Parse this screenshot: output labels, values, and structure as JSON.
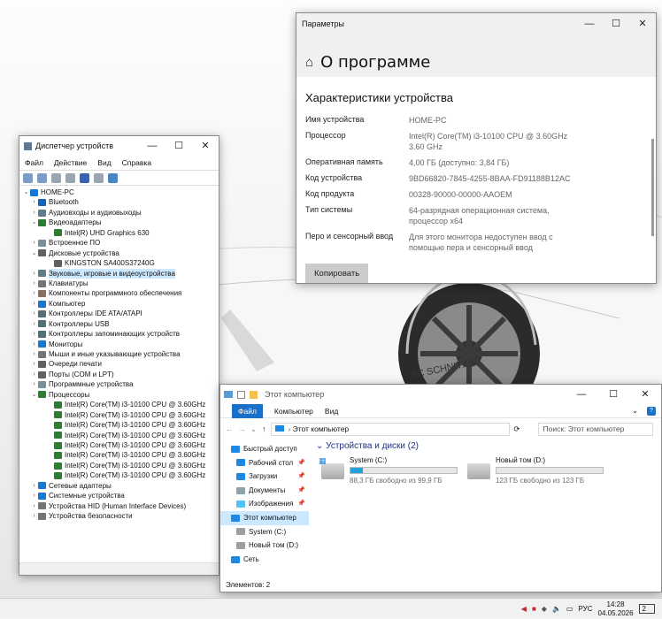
{
  "settings": {
    "window_title": "Параметры",
    "page_title": "О программе",
    "section_title": "Характеристики устройства",
    "specs": [
      {
        "key": "Имя устройства",
        "value": "HOME-PC"
      },
      {
        "key": "Процессор",
        "value": "Intel(R) Core(TM) i3-10100 CPU @ 3.60GHz 3.60 GHz"
      },
      {
        "key": "Оперативная память",
        "value": "4,00 ГБ (доступно: 3,84 ГБ)"
      },
      {
        "key": "Код устройства",
        "value": "9BD66820-7845-4255-8BAA-FD91188B12AC"
      },
      {
        "key": "Код продукта",
        "value": "00328-90000-00000-AAOEM"
      },
      {
        "key": "Тип системы",
        "value": "64-разрядная операционная система, процессор x64"
      },
      {
        "key": "Перо и сенсорный ввод",
        "value": "Для этого монитора недоступен ввод с помощью пера и сенсорный ввод"
      }
    ],
    "copy_button": "Копировать"
  },
  "devmgr": {
    "window_title": "Диспетчер устройств",
    "menu": [
      "Файл",
      "Действие",
      "Вид",
      "Справка"
    ],
    "root": "HOME-PC",
    "nodes": [
      {
        "label": "Bluetooth",
        "level": 1,
        "arrow": "›",
        "icon": "bluetooth-icon",
        "color": "#1565c0"
      },
      {
        "label": "Аудиовходы и аудиовыходы",
        "level": 1,
        "arrow": "›",
        "icon": "speaker-icon",
        "color": "#607d8b"
      },
      {
        "label": "Видеоадаптеры",
        "level": 1,
        "arrow": "⌄",
        "icon": "display-adapter-icon",
        "color": "#2e7d32"
      },
      {
        "label": "Intel(R) UHD Graphics 630",
        "level": 2,
        "arrow": "",
        "icon": "display-adapter-icon",
        "color": "#2e7d32"
      },
      {
        "label": "Встроенное ПО",
        "level": 1,
        "arrow": "›",
        "icon": "firmware-icon",
        "color": "#78909c"
      },
      {
        "label": "Дисковые устройства",
        "level": 1,
        "arrow": "⌄",
        "icon": "disk-icon",
        "color": "#616161"
      },
      {
        "label": "KINGSTON SA400S37240G",
        "level": 2,
        "arrow": "",
        "icon": "disk-icon",
        "color": "#616161"
      },
      {
        "label": "Звуковые, игровые и видеоустройства",
        "level": 1,
        "arrow": "›",
        "icon": "sound-icon",
        "color": "#607d8b",
        "selected": true
      },
      {
        "label": "Клавиатуры",
        "level": 1,
        "arrow": "›",
        "icon": "keyboard-icon",
        "color": "#757575"
      },
      {
        "label": "Компоненты программного обеспечения",
        "level": 1,
        "arrow": "›",
        "icon": "software-icon",
        "color": "#8d6e63"
      },
      {
        "label": "Компьютер",
        "level": 1,
        "arrow": "›",
        "icon": "computer-icon",
        "color": "#1976d2"
      },
      {
        "label": "Контроллеры IDE ATA/ATAPI",
        "level": 1,
        "arrow": "›",
        "icon": "controller-icon",
        "color": "#546e7a"
      },
      {
        "label": "Контроллеры USB",
        "level": 1,
        "arrow": "›",
        "icon": "usb-icon",
        "color": "#546e7a"
      },
      {
        "label": "Контроллеры запоминающих устройств",
        "level": 1,
        "arrow": "›",
        "icon": "storage-icon",
        "color": "#546e7a"
      },
      {
        "label": "Мониторы",
        "level": 1,
        "arrow": "›",
        "icon": "monitor-icon",
        "color": "#1976d2"
      },
      {
        "label": "Мыши и иные указывающие устройства",
        "level": 1,
        "arrow": "›",
        "icon": "mouse-icon",
        "color": "#757575"
      },
      {
        "label": "Очереди печати",
        "level": 1,
        "arrow": "›",
        "icon": "printer-icon",
        "color": "#616161"
      },
      {
        "label": "Порты (COM и LPT)",
        "level": 1,
        "arrow": "›",
        "icon": "port-icon",
        "color": "#616161"
      },
      {
        "label": "Программные устройства",
        "level": 1,
        "arrow": "›",
        "icon": "software-device-icon",
        "color": "#78909c"
      },
      {
        "label": "Процессоры",
        "level": 1,
        "arrow": "⌄",
        "icon": "processor-icon",
        "color": "#2e7d32"
      },
      {
        "label": "Intel(R) Core(TM) i3-10100 CPU @ 3.60GHz",
        "level": 2,
        "arrow": "",
        "icon": "processor-icon",
        "color": "#2e7d32"
      },
      {
        "label": "Intel(R) Core(TM) i3-10100 CPU @ 3.60GHz",
        "level": 2,
        "arrow": "",
        "icon": "processor-icon",
        "color": "#2e7d32"
      },
      {
        "label": "Intel(R) Core(TM) i3-10100 CPU @ 3.60GHz",
        "level": 2,
        "arrow": "",
        "icon": "processor-icon",
        "color": "#2e7d32"
      },
      {
        "label": "Intel(R) Core(TM) i3-10100 CPU @ 3.60GHz",
        "level": 2,
        "arrow": "",
        "icon": "processor-icon",
        "color": "#2e7d32"
      },
      {
        "label": "Intel(R) Core(TM) i3-10100 CPU @ 3.60GHz",
        "level": 2,
        "arrow": "",
        "icon": "processor-icon",
        "color": "#2e7d32"
      },
      {
        "label": "Intel(R) Core(TM) i3-10100 CPU @ 3.60GHz",
        "level": 2,
        "arrow": "",
        "icon": "processor-icon",
        "color": "#2e7d32"
      },
      {
        "label": "Intel(R) Core(TM) i3-10100 CPU @ 3.60GHz",
        "level": 2,
        "arrow": "",
        "icon": "processor-icon",
        "color": "#2e7d32"
      },
      {
        "label": "Intel(R) Core(TM) i3-10100 CPU @ 3.60GHz",
        "level": 2,
        "arrow": "",
        "icon": "processor-icon",
        "color": "#2e7d32"
      },
      {
        "label": "Сетевые адаптеры",
        "level": 1,
        "arrow": "›",
        "icon": "network-adapter-icon",
        "color": "#1976d2"
      },
      {
        "label": "Системные устройства",
        "level": 1,
        "arrow": "›",
        "icon": "system-device-icon",
        "color": "#1976d2"
      },
      {
        "label": "Устройства HID (Human Interface Devices)",
        "level": 1,
        "arrow": "›",
        "icon": "hid-icon",
        "color": "#757575"
      },
      {
        "label": "Устройства безопасности",
        "level": 1,
        "arrow": "›",
        "icon": "security-device-icon",
        "color": "#757575"
      }
    ]
  },
  "explorer": {
    "window_title": "Этот компьютер",
    "ribbon_tabs": [
      "Файл",
      "Компьютер",
      "Вид"
    ],
    "address": "Этот компьютер",
    "search_placeholder": "Поиск: Этот компьютер",
    "nav": [
      {
        "label": "Быстрый доступ",
        "icon": "star-icon",
        "color": "#1e88e5",
        "pinned": false,
        "indent": 0
      },
      {
        "label": "Рабочий стол",
        "icon": "desktop-icon",
        "color": "#1e88e5",
        "pinned": true,
        "indent": 1
      },
      {
        "label": "Загрузки",
        "icon": "download-icon",
        "color": "#1e88e5",
        "pinned": true,
        "indent": 1
      },
      {
        "label": "Документы",
        "icon": "documents-icon",
        "color": "#90a4ae",
        "pinned": true,
        "indent": 1
      },
      {
        "label": "Изображения",
        "icon": "pictures-icon",
        "color": "#4fc3f7",
        "pinned": true,
        "indent": 1
      },
      {
        "label": "Этот компьютер",
        "icon": "computer-icon",
        "color": "#1e88e5",
        "pinned": false,
        "indent": 0,
        "selected": true
      },
      {
        "label": "System (C:)",
        "icon": "drive-icon",
        "color": "#9e9e9e",
        "pinned": false,
        "indent": 1
      },
      {
        "label": "Новый том (D:)",
        "icon": "drive-icon",
        "color": "#9e9e9e",
        "pinned": false,
        "indent": 1
      },
      {
        "label": "Сеть",
        "icon": "network-icon",
        "color": "#1e88e5",
        "pinned": false,
        "indent": 0
      }
    ],
    "group_title": "Устройства и диски (2)",
    "drives": [
      {
        "name": "System (C:)",
        "free": "88,3 ГБ свободно из 99,9 ГБ",
        "used_fraction": 0.12,
        "icon": "windows-drive-icon"
      },
      {
        "name": "Новый том (D:)",
        "free": "123 ГБ свободно из 123 ГБ",
        "used_fraction": 0.0,
        "icon": "drive-icon"
      }
    ],
    "status": "Элементов: 2"
  },
  "taskbar": {
    "lang": "РУС",
    "time": "14:28",
    "date": "04.05.2026",
    "notifications": "2"
  },
  "colors": {
    "accent": "#1a6fc9",
    "selection": "#cce8ff",
    "group_title": "#1e3287"
  }
}
